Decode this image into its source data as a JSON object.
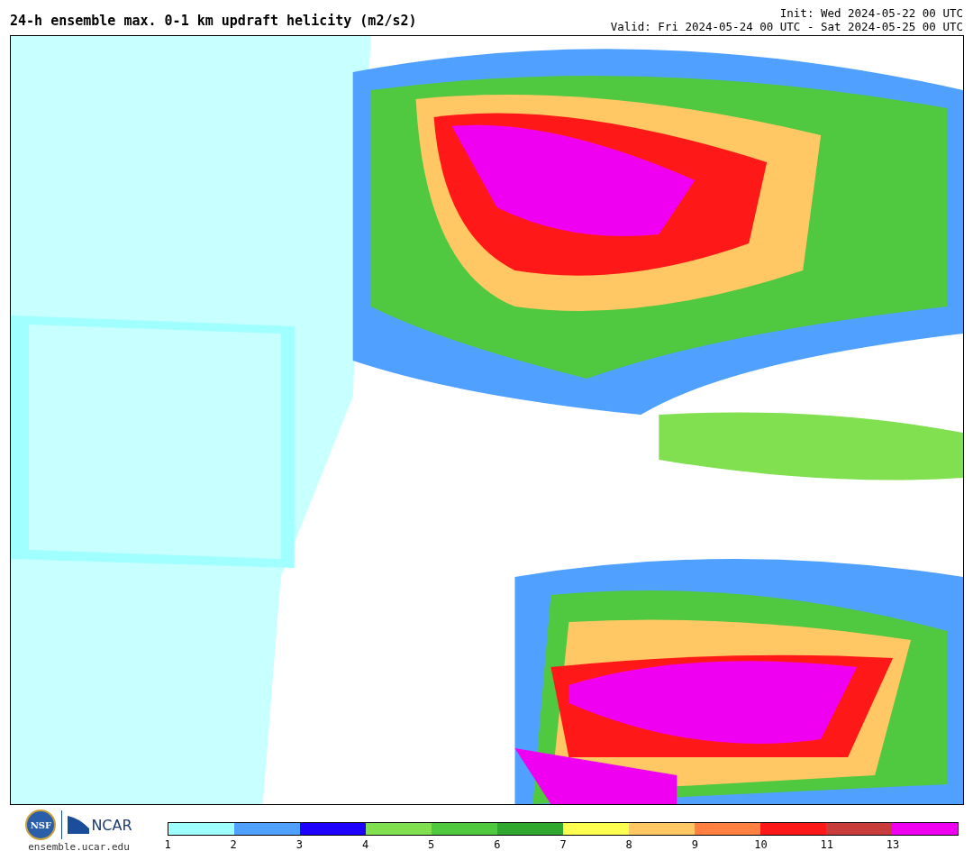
{
  "header": {
    "title": "24-h ensemble max. 0-1 km updraft helicity (m2/s2)",
    "init": "Init: Wed 2024-05-22 00 UTC",
    "valid": "Valid: Fri 2024-05-24 00 UTC - Sat 2024-05-25 00 UTC"
  },
  "footer": {
    "logo_nsf": "NSF",
    "logo_ncar": "NCAR",
    "site": "ensemble.ucar.edu"
  },
  "legend": [
    {
      "label": "1",
      "color": "#a0ffff"
    },
    {
      "label": "2",
      "color": "#50a0ff"
    },
    {
      "label": "3",
      "color": "#1e00ff"
    },
    {
      "label": "4",
      "color": "#80e050"
    },
    {
      "label": "5",
      "color": "#50c840"
    },
    {
      "label": "6",
      "color": "#30a830"
    },
    {
      "label": "7",
      "color": "#ffff50"
    },
    {
      "label": "8",
      "color": "#ffc864"
    },
    {
      "label": "9",
      "color": "#ff8040"
    },
    {
      "label": "10",
      "color": "#ff1818"
    },
    {
      "label": "11",
      "color": "#c83c3c"
    },
    {
      "label": "13",
      "color": "#f000f0"
    }
  ]
}
